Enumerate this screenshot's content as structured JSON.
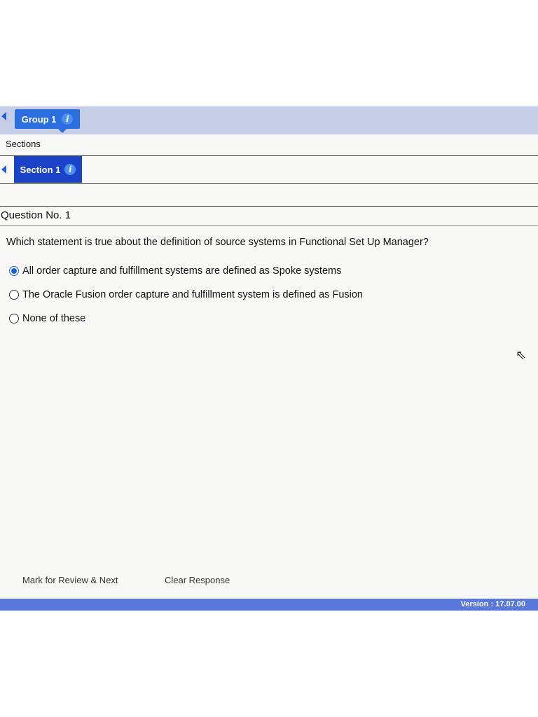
{
  "group": {
    "label": "Group 1",
    "info_icon": "info-icon"
  },
  "sections_label": "Sections",
  "section": {
    "label": "Section 1",
    "info_icon": "info-icon"
  },
  "question": {
    "number_label": "Question No. 1",
    "text": "Which statement is true about the definition of source systems in Functional Set Up Manager?",
    "options": [
      {
        "label": "All order capture and fulfillment systems are defined as Spoke systems",
        "selected": true
      },
      {
        "label": "The Oracle Fusion order capture and fulfillment system is defined as Fusion",
        "selected": false
      },
      {
        "label": "None of these",
        "selected": false
      }
    ]
  },
  "footer": {
    "mark_review": "Mark for Review & Next",
    "clear": "Clear Response"
  },
  "version": "Version : 17.07.00",
  "colors": {
    "accent": "#2a6ee0",
    "section": "#1a43c8",
    "bar": "#5878dc"
  }
}
